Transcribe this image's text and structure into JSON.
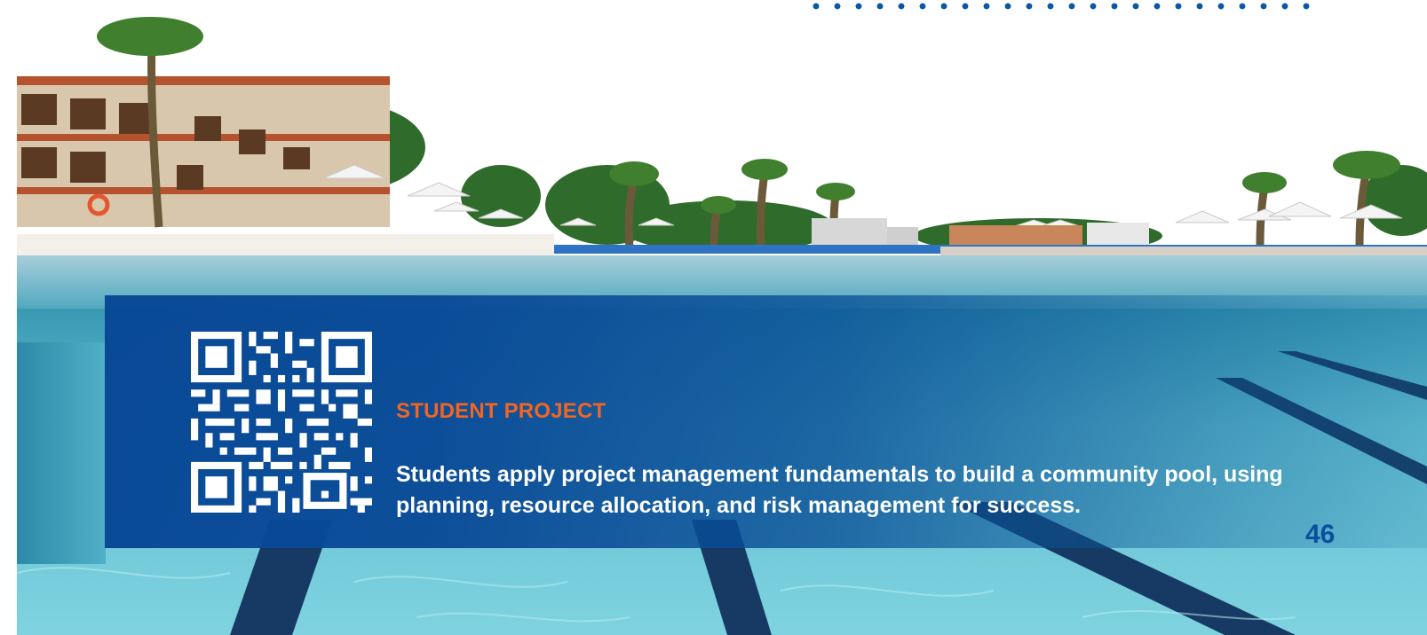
{
  "decoration": {
    "accent_color": "#0d56a0",
    "dots_icon": "dotted-line-decoration"
  },
  "photo": {
    "subject": "outdoor-swimming-pool-with-resort",
    "icon": "pool-photo"
  },
  "panel": {
    "background_color": "#084896",
    "qr_icon": "qr-code-icon",
    "label": "STUDENT PROJECT",
    "label_color": "#f26522",
    "description": "Students apply project management fundamentals to build a community pool, using planning, resource allocation, and risk management for success."
  },
  "page": {
    "number": "46",
    "number_color": "#0b4f9c"
  }
}
